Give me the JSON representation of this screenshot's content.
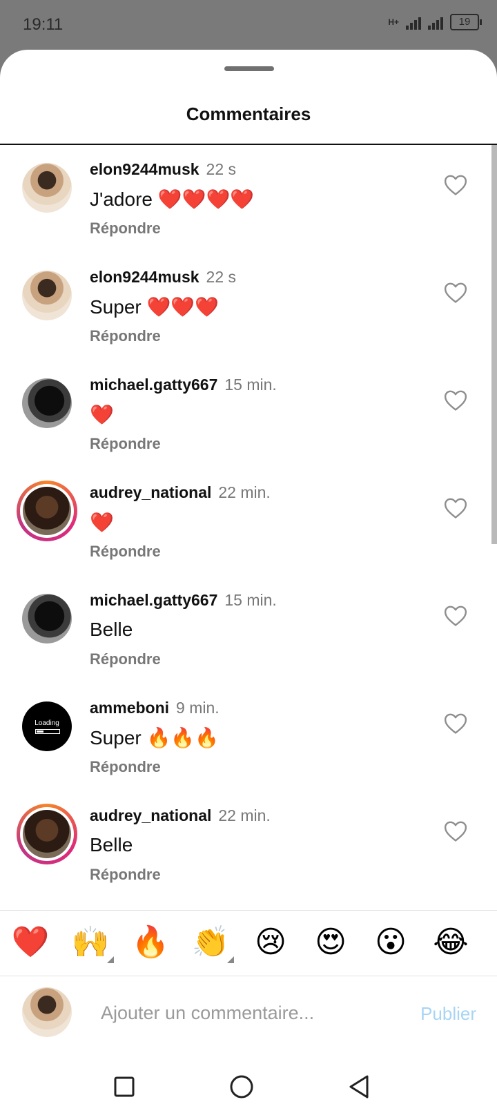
{
  "status": {
    "time": "19:11",
    "network": "H+",
    "battery": "19"
  },
  "sheet": {
    "title": "Commentaires"
  },
  "comments": [
    {
      "user": "elon9244musk",
      "time": "22 s",
      "text": "J'adore ❤️❤️❤️❤️",
      "reply": "Répondre",
      "avatar": "elon"
    },
    {
      "user": "elon9244musk",
      "time": "22 s",
      "text": "Super ❤️❤️❤️",
      "reply": "Répondre",
      "avatar": "elon"
    },
    {
      "user": "michael.gatty667",
      "time": "15 min.",
      "text": "❤️",
      "reply": "Répondre",
      "avatar": "michael"
    },
    {
      "user": "audrey_national",
      "time": "22 min.",
      "text": "❤️",
      "reply": "Répondre",
      "avatar": "audrey"
    },
    {
      "user": "michael.gatty667",
      "time": "15 min.",
      "text": "Belle",
      "reply": "Répondre",
      "avatar": "michael"
    },
    {
      "user": "ammeboni",
      "time": "9 min.",
      "text": "Super 🔥🔥🔥",
      "reply": "Répondre",
      "avatar": "loading"
    },
    {
      "user": "audrey_national",
      "time": "22 min.",
      "text": "Belle",
      "reply": "Répondre",
      "avatar": "audrey"
    }
  ],
  "loading_avatar_text": "Loading",
  "reactions": [
    "❤️",
    "🙌",
    "🔥",
    "👏",
    "😢",
    "😍",
    "😮",
    "😂"
  ],
  "composer": {
    "placeholder": "Ajouter un commentaire...",
    "publish": "Publier"
  },
  "colors": {
    "accent_disabled": "#a8d4f5",
    "heart_outline": "#8e8e8e",
    "ring_start": "#f58529",
    "ring_end": "#dd2a7b"
  }
}
